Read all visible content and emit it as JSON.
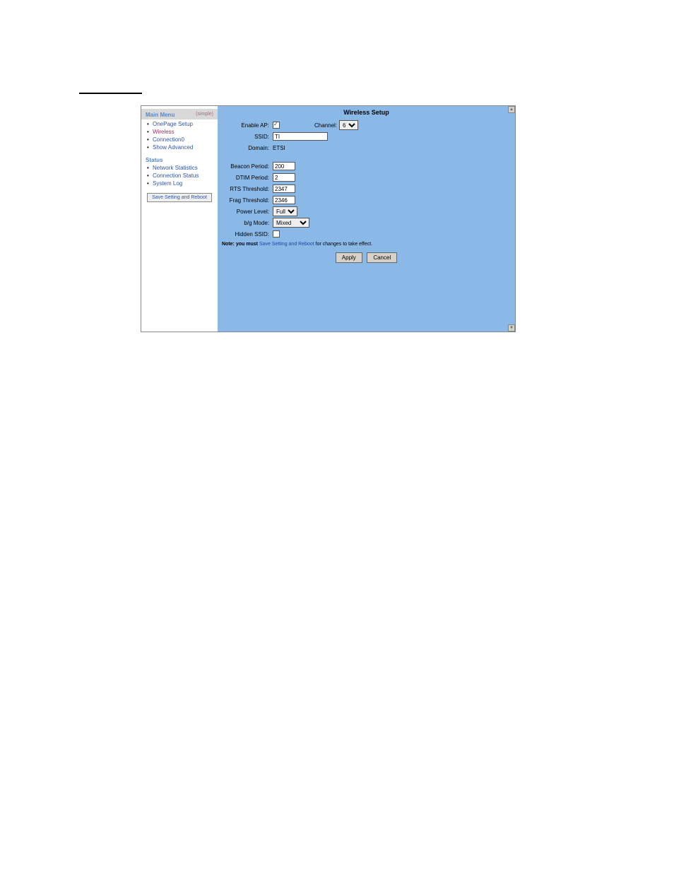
{
  "sidebar": {
    "main_menu_label": "Main Menu",
    "mode_label": "(simple)",
    "main_items": [
      {
        "label": "OnePage Setup"
      },
      {
        "label": "Wireless"
      },
      {
        "label": "Connection0"
      },
      {
        "label": "Show Advanced"
      }
    ],
    "status_label": "Status",
    "status_items": [
      {
        "label": "Network Statistics"
      },
      {
        "label": "Connection Status"
      },
      {
        "label": "System Log"
      }
    ],
    "save_reboot_btn": "Save Setting and Reboot"
  },
  "content": {
    "title": "Wireless Setup",
    "labels": {
      "enable_ap": "Enable AP:",
      "channel": "Channel:",
      "ssid": "SSID:",
      "domain": "Domain:",
      "beacon_period": "Beacon Period:",
      "dtim_period": "DTIM Period:",
      "rts_threshold": "RTS Threshold:",
      "frag_threshold": "Frag Threshold:",
      "power_level": "Power Level:",
      "bg_mode": "b/g Mode:",
      "hidden_ssid": "Hidden SSID:"
    },
    "values": {
      "enable_ap_checked": true,
      "channel": "6",
      "ssid": "TI",
      "domain": "ETSI",
      "beacon_period": "200",
      "dtim_period": "2",
      "rts_threshold": "2347",
      "frag_threshold": "2346",
      "power_level": "Full",
      "bg_mode": "Mixed",
      "hidden_ssid_checked": false
    },
    "note": {
      "prefix": "Note: you must ",
      "link": "Save Setting and Reboot",
      "suffix": " for changes to take effect."
    },
    "buttons": {
      "apply": "Apply",
      "cancel": "Cancel"
    }
  }
}
